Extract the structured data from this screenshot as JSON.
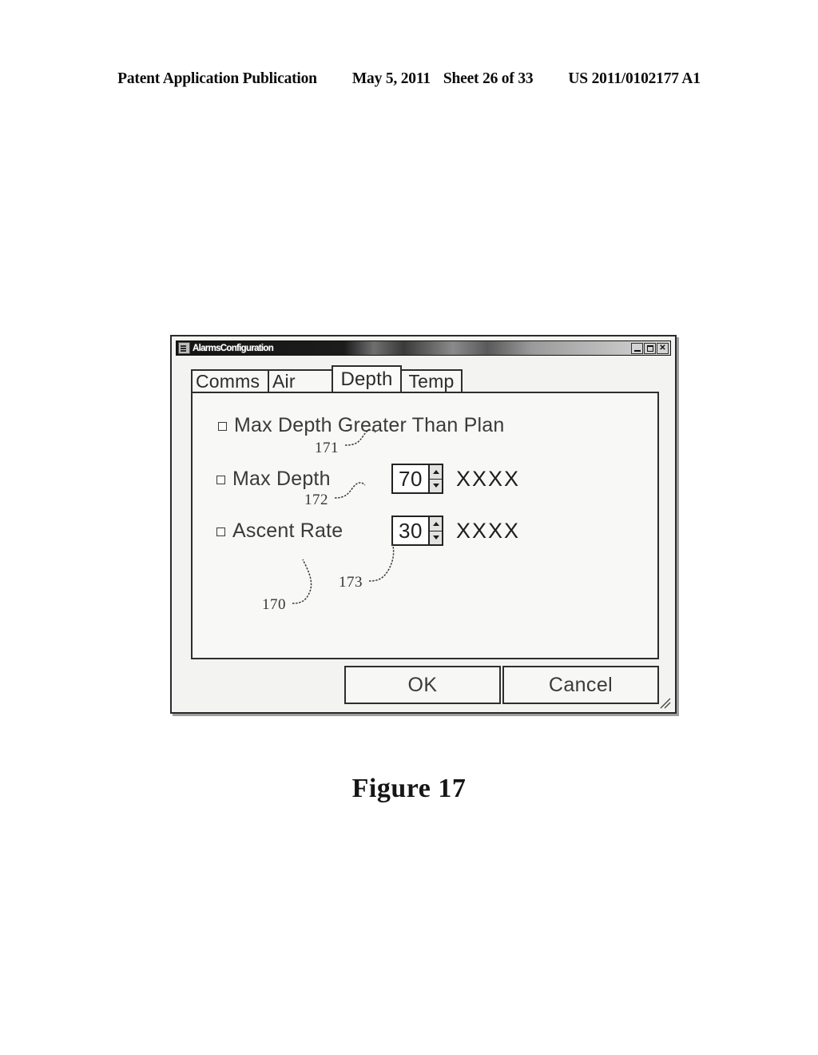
{
  "page_header": {
    "publication": "Patent Application Publication",
    "date": "May 5, 2011",
    "sheet": "Sheet 26 of 33",
    "patent_number": "US 2011/0102177 A1"
  },
  "figure": {
    "caption": "Figure 17"
  },
  "dialog": {
    "title": "AlarmsConfiguration",
    "sysmenu_icon": "system-menu-icon",
    "window_buttons": [
      {
        "name": "minimize-button",
        "label": "",
        "icon": "minimize-icon"
      },
      {
        "name": "maximize-button",
        "label": "",
        "icon": "maximize-icon"
      },
      {
        "name": "close-button",
        "label": "✕",
        "icon": "close-icon"
      }
    ],
    "tabs": [
      {
        "label": "Comms",
        "selected": false
      },
      {
        "label": "Air",
        "selected": false
      },
      {
        "label": "Depth",
        "selected": true
      },
      {
        "label": "Temp",
        "selected": false
      }
    ],
    "options": [
      {
        "label": "Max Depth Greater Than Plan",
        "checked": false,
        "has_spinner": false,
        "unit": ""
      },
      {
        "label": "Max Depth",
        "checked": false,
        "has_spinner": true,
        "value": "70",
        "unit": "XXXX"
      },
      {
        "label": "Ascent Rate",
        "checked": false,
        "has_spinner": true,
        "value": "30",
        "unit": "XXXX"
      }
    ],
    "buttons": {
      "ok": "OK",
      "cancel": "Cancel"
    },
    "resize_grip_icon": "resize-grip-icon"
  },
  "reference_numerals": [
    {
      "id": "170",
      "label": "170",
      "points_to": "alarms-configuration-dialog"
    },
    {
      "id": "171",
      "label": "171",
      "points_to": "max-depth-greater-than-plan-checkbox"
    },
    {
      "id": "172",
      "label": "172",
      "points_to": "max-depth-spinner"
    },
    {
      "id": "173",
      "label": "173",
      "points_to": "ascent-rate-spinner"
    }
  ]
}
